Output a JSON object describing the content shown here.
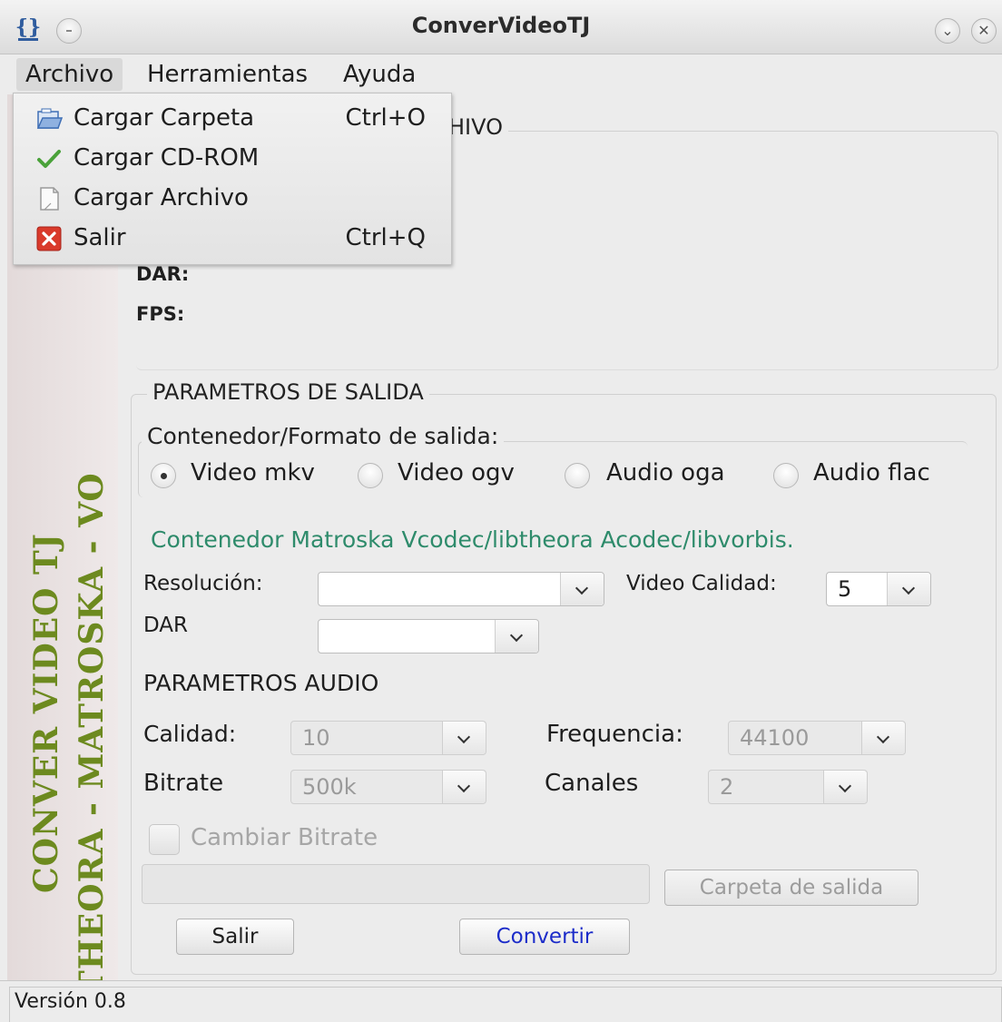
{
  "window": {
    "title": "ConverVideoTJ",
    "app_icon": "{}",
    "close_glyph": "✕",
    "dropdown_glyph": "⌄"
  },
  "menubar": {
    "items": [
      {
        "label": "Archivo"
      },
      {
        "label": "Herramientas"
      },
      {
        "label": "Ayuda"
      }
    ]
  },
  "archivo_menu": {
    "items": [
      {
        "label": "Cargar Carpeta",
        "accel": "Ctrl+O",
        "icon": "folder-icon"
      },
      {
        "label": "Cargar CD-ROM",
        "accel": "",
        "icon": "checkmark-icon"
      },
      {
        "label": "Cargar Archivo",
        "accel": "",
        "icon": "file-icon"
      },
      {
        "label": "Salir",
        "accel": "Ctrl+Q",
        "icon": "exit-icon"
      }
    ]
  },
  "sidebar": {
    "line1": "CONVER VIDEO TJ",
    "line2": "THEORA - MATROSKA - VO"
  },
  "file_info": {
    "legend_partial": "HIVO",
    "dar_label": "DAR:",
    "fps_label": "FPS:"
  },
  "output": {
    "legend": "PARAMETROS DE SALIDA",
    "container_legend": "Contenedor/Formato de salida:",
    "formats": [
      {
        "label": "Video mkv",
        "checked": true
      },
      {
        "label": "Video ogv",
        "checked": false
      },
      {
        "label": "Audio oga",
        "checked": false
      },
      {
        "label": "Audio flac",
        "checked": false
      }
    ],
    "description": "Contenedor Matroska Vcodec/libtheora Acodec/libvorbis.",
    "resolution_label": "Resolución:",
    "resolution_value": "",
    "video_quality_label": "Video Calidad:",
    "video_quality_value": "5",
    "dar_label": "DAR",
    "dar_value": ""
  },
  "audio": {
    "heading": "PARAMETROS AUDIO",
    "quality_label": "Calidad:",
    "quality_value": "10",
    "frequency_label": "Frequencia:",
    "frequency_value": "44100",
    "bitrate_label": "Bitrate",
    "bitrate_value": "500k",
    "channels_label": "Canales",
    "channels_value": "2",
    "change_bitrate_label": "Cambiar Bitrate"
  },
  "output_folder": {
    "path_value": "",
    "button_label": "Carpeta de salida"
  },
  "actions": {
    "exit_label": "Salir",
    "convert_label": "Convertir"
  },
  "status": {
    "version": "Versión 0.8"
  },
  "colors": {
    "accent_green": "#2e8b6b",
    "banner_olive": "#6d8a1f",
    "convert_blue": "#1c2cc9"
  }
}
